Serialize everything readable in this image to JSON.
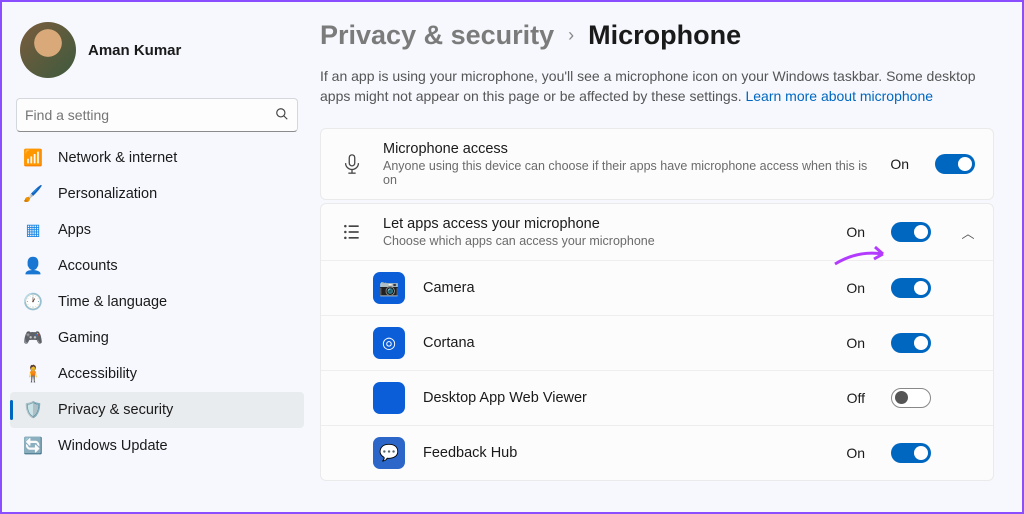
{
  "profile": {
    "name": "Aman Kumar"
  },
  "search": {
    "placeholder": "Find a setting"
  },
  "nav": {
    "items": [
      {
        "label": "Network & internet",
        "icon": "📶",
        "cls": "ic-wifi"
      },
      {
        "label": "Personalization",
        "icon": "🖌️",
        "cls": "ic-brush"
      },
      {
        "label": "Apps",
        "icon": "▦",
        "cls": "ic-apps"
      },
      {
        "label": "Accounts",
        "icon": "👤",
        "cls": "ic-acct"
      },
      {
        "label": "Time & language",
        "icon": "🕐",
        "cls": "ic-time"
      },
      {
        "label": "Gaming",
        "icon": "🎮",
        "cls": "ic-game"
      },
      {
        "label": "Accessibility",
        "icon": "🧍",
        "cls": "ic-acc"
      },
      {
        "label": "Privacy & security",
        "icon": "🛡️",
        "cls": "ic-priv",
        "active": true
      },
      {
        "label": "Windows Update",
        "icon": "🔄",
        "cls": "ic-upd"
      }
    ]
  },
  "breadcrumb": {
    "parent": "Privacy & security",
    "sep": "›",
    "current": "Microphone"
  },
  "intro": {
    "text": "If an app is using your microphone, you'll see a microphone icon on your Windows taskbar. Some desktop apps might not appear on this page or be affected by these settings.  ",
    "link": "Learn more about microphone"
  },
  "micAccess": {
    "title": "Microphone access",
    "sub": "Anyone using this device can choose if their apps have microphone access when this is on",
    "state": "On",
    "on": true
  },
  "appsAccess": {
    "title": "Let apps access your microphone",
    "sub": "Choose which apps can access your microphone",
    "state": "On",
    "on": true
  },
  "apps": [
    {
      "name": "Camera",
      "state": "On",
      "on": true,
      "bg": "#0b5ed7",
      "glyph": "📷"
    },
    {
      "name": "Cortana",
      "state": "On",
      "on": true,
      "bg": "#0b5ed7",
      "glyph": "◎"
    },
    {
      "name": "Desktop App Web Viewer",
      "state": "Off",
      "on": false,
      "bg": "#0b5ed7",
      "glyph": ""
    },
    {
      "name": "Feedback Hub",
      "state": "On",
      "on": true,
      "bg": "#2b66c8",
      "glyph": "💬"
    }
  ]
}
